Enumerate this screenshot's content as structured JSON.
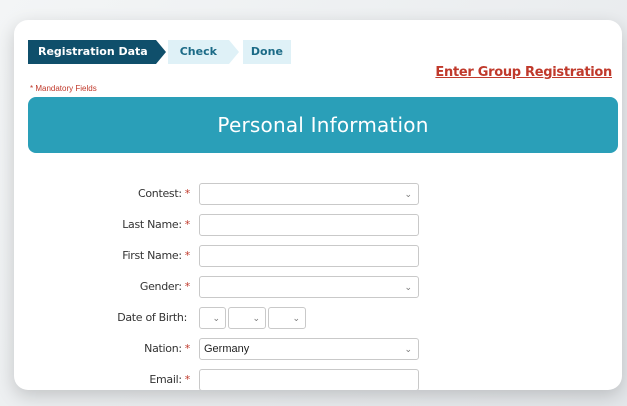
{
  "stepper": {
    "steps": [
      {
        "label": "Registration Data",
        "state": "active"
      },
      {
        "label": "Check",
        "state": "upcoming"
      },
      {
        "label": "Done",
        "state": "upcoming"
      }
    ]
  },
  "mandatory_note": "* Mandatory Fields",
  "group_registration_link": "Enter Group Registration",
  "banner_title": "Personal Information",
  "form": {
    "contest": {
      "label": "Contest:",
      "required": "*",
      "value": ""
    },
    "last_name": {
      "label": "Last Name:",
      "required": "*",
      "value": ""
    },
    "first_name": {
      "label": "First Name:",
      "required": "*",
      "value": ""
    },
    "gender": {
      "label": "Gender:",
      "required": "*",
      "value": ""
    },
    "dob": {
      "label": "Date of Birth:",
      "required": ""
    },
    "nation": {
      "label": "Nation:",
      "required": "*",
      "value": "Germany"
    },
    "email": {
      "label": "Email:",
      "required": "*",
      "value": ""
    }
  },
  "icons": {
    "dropdown": "chevron-down-icon",
    "dropdown_glyph": "⌄"
  },
  "colors": {
    "stepper_active": "#0f4f6b",
    "stepper_inactive": "#dff1f7",
    "banner": "#2a9fb8",
    "required": "#c0392b",
    "link": "#c0392b"
  }
}
